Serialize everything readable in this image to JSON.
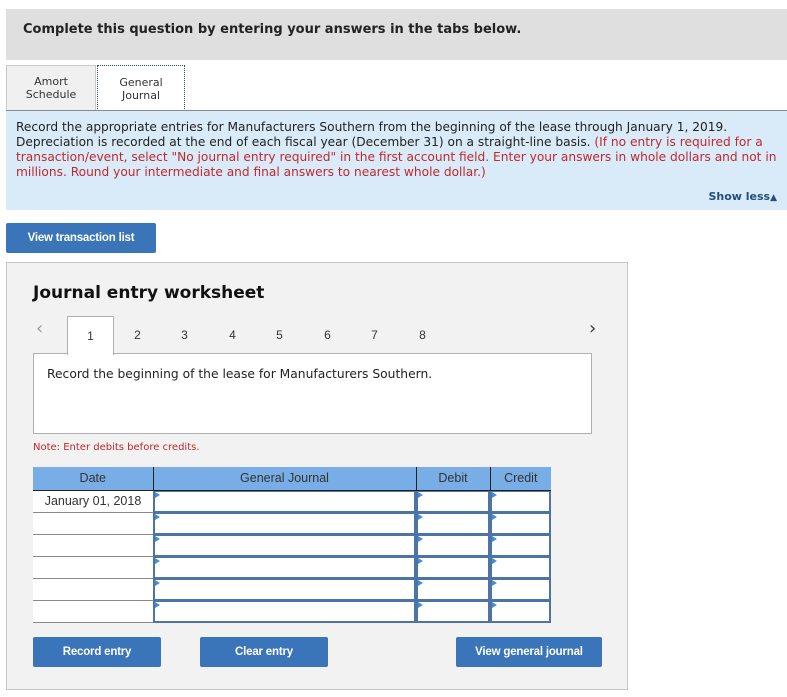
{
  "banner": {
    "title": "Complete this question by entering your answers in the tabs below."
  },
  "tabs": [
    {
      "label_line1": "Amort",
      "label_line2": "Schedule",
      "active": false
    },
    {
      "label_line1": "General",
      "label_line2": "Journal",
      "active": true
    }
  ],
  "instructions": {
    "text_main": "Record the appropriate entries for Manufacturers Southern from the beginning of the lease through January 1, 2019. Depreciation is recorded at the end of each fiscal year (December 31) on a straight-line basis. ",
    "text_red": "(If no entry is required for a transaction/event, select \"No journal entry required\" in the first account field. Enter your answers in whole dollars and not in millions. Round your intermediate and final answers to nearest whole dollar.)",
    "show_less_label": "Show less",
    "show_less_icon": "triangle-up-icon"
  },
  "buttons": {
    "view_transaction_list": "View transaction list",
    "record_entry": "Record entry",
    "clear_entry": "Clear entry",
    "view_general_journal": "View general journal"
  },
  "worksheet": {
    "title": "Journal entry worksheet",
    "pager": {
      "prev_icon": "chevron-left-icon",
      "next_icon": "chevron-right-icon",
      "pages": [
        "1",
        "2",
        "3",
        "4",
        "5",
        "6",
        "7",
        "8"
      ],
      "active_page": "1"
    },
    "description": "Record the beginning of the lease for Manufacturers Southern.",
    "note": "Note: Enter debits before credits.",
    "table": {
      "headers": [
        "Date",
        "General Journal",
        "Debit",
        "Credit"
      ],
      "rows": [
        {
          "date": "January 01, 2018",
          "account": "",
          "debit": "",
          "credit": ""
        },
        {
          "date": "",
          "account": "",
          "debit": "",
          "credit": ""
        },
        {
          "date": "",
          "account": "",
          "debit": "",
          "credit": ""
        },
        {
          "date": "",
          "account": "",
          "debit": "",
          "credit": ""
        },
        {
          "date": "",
          "account": "",
          "debit": "",
          "credit": ""
        },
        {
          "date": "",
          "account": "",
          "debit": "",
          "credit": ""
        }
      ]
    }
  },
  "colors": {
    "accent_button": "#3a74b9",
    "table_header": "#78aee5",
    "instruction_bg": "#d9ebf9",
    "warning_red": "#c0282e"
  }
}
